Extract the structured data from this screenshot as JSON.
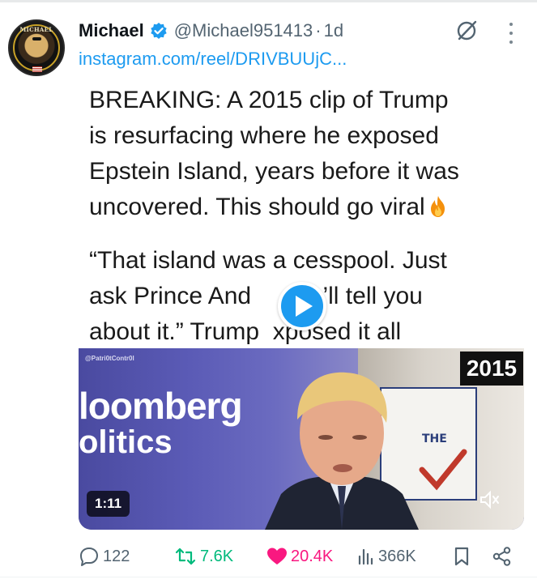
{
  "author": {
    "name": "Michael",
    "handle": "@Michael951413",
    "separator": "·",
    "time": "1d",
    "avatar_text": "MICHAEL"
  },
  "link": "instagram.com/reel/DRIVBUUjC...",
  "caption": {
    "line1": "BREAKING: A 2015 clip of Trump",
    "line2": "is resurfacing where he exposed",
    "line3": "Epstein Island, years before it was",
    "line4": "uncovered. This should go viral",
    "line5": "“That island was a cesspool. Just",
    "line6": "ask Prince And      He’ll tell you",
    "line7": "about it.” Trump  xposed it all"
  },
  "video": {
    "watermark": "@Patri0tContr0l",
    "bloomberg_line1": "loomberg",
    "bloomberg_line2": "olitics",
    "sign_text": "THE",
    "year_badge": "2015",
    "duration": "1:11"
  },
  "actions": {
    "replies": "122",
    "reposts": "7.6K",
    "likes": "20.4K",
    "views": "366K"
  },
  "colors": {
    "accent": "#1d9bf0",
    "muted": "#536471",
    "repost": "#00ba7c",
    "like": "#f91880"
  }
}
